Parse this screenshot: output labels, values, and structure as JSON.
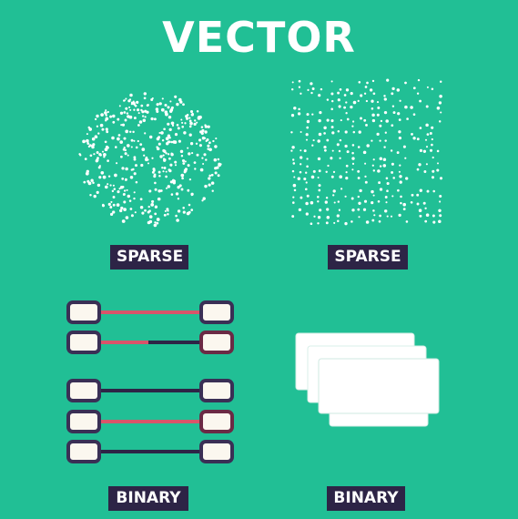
{
  "title": "VECTOR",
  "panels": [
    {
      "label": "SPARSE",
      "style": "circular-dot-cloud"
    },
    {
      "label": "SPARSE",
      "style": "square-dot-grid"
    },
    {
      "label": "BINARY",
      "style": "linked-node-pairs"
    },
    {
      "label": "BINARY",
      "style": "stacked-cards"
    }
  ],
  "colors": {
    "background": "#21bf95",
    "label_background": "#2d2446",
    "text": "#ffffff",
    "dot": "#ffffff",
    "link_red": "#d9546a",
    "link_navy": "#2d2446",
    "node_fill": "#fbf7ef",
    "node_border": "#3a2f55",
    "card_fill": "#ffffff"
  }
}
